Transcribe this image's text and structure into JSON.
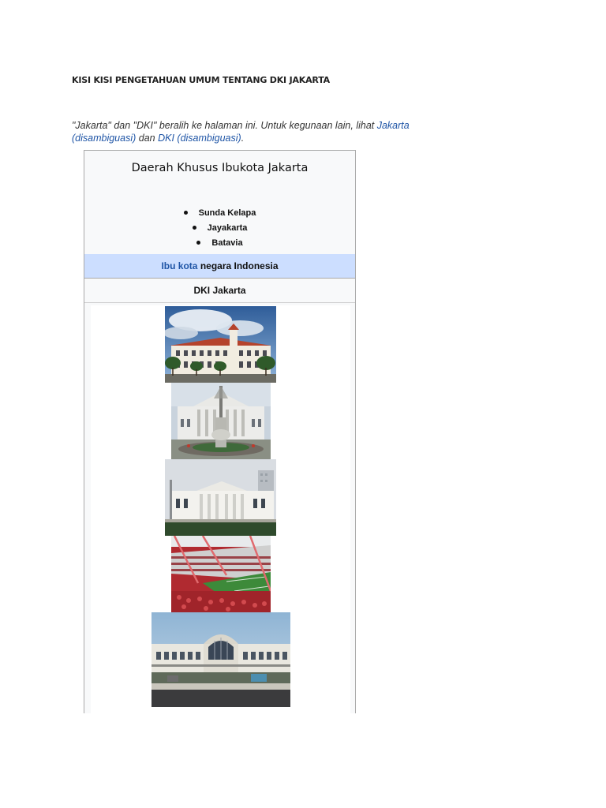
{
  "document": {
    "title": "KISI KISI PENGETAHUAN UMUM TENTANG DKI JAKARTA"
  },
  "hatnote": {
    "text_start": "\"Jakarta\" dan \"DKI\" beralih ke halaman ini. Untuk kegunaan lain, lihat ",
    "link1": "Jakarta (disambiguasi)",
    "text_mid": " dan ",
    "link2": "DKI (disambiguasi)",
    "text_end": ".",
    "link_color": "#1f55a6"
  },
  "infobox": {
    "name": "Daerah Khusus Ibukota Jakarta",
    "former_names": [
      "Sunda Kelapa",
      "Jayakarta",
      "Batavia"
    ],
    "status_link": "Ibu kota",
    "status_text": " negara Indonesia",
    "status_bg": "#ccdeff",
    "caption": "DKI Jakarta",
    "montage": [
      {
        "icon": "colonial-hall-photo"
      },
      {
        "icon": "museum-monument-photo"
      },
      {
        "icon": "palace-photo"
      },
      {
        "icon": "stadium-photo"
      },
      {
        "icon": "station-photo"
      }
    ]
  }
}
